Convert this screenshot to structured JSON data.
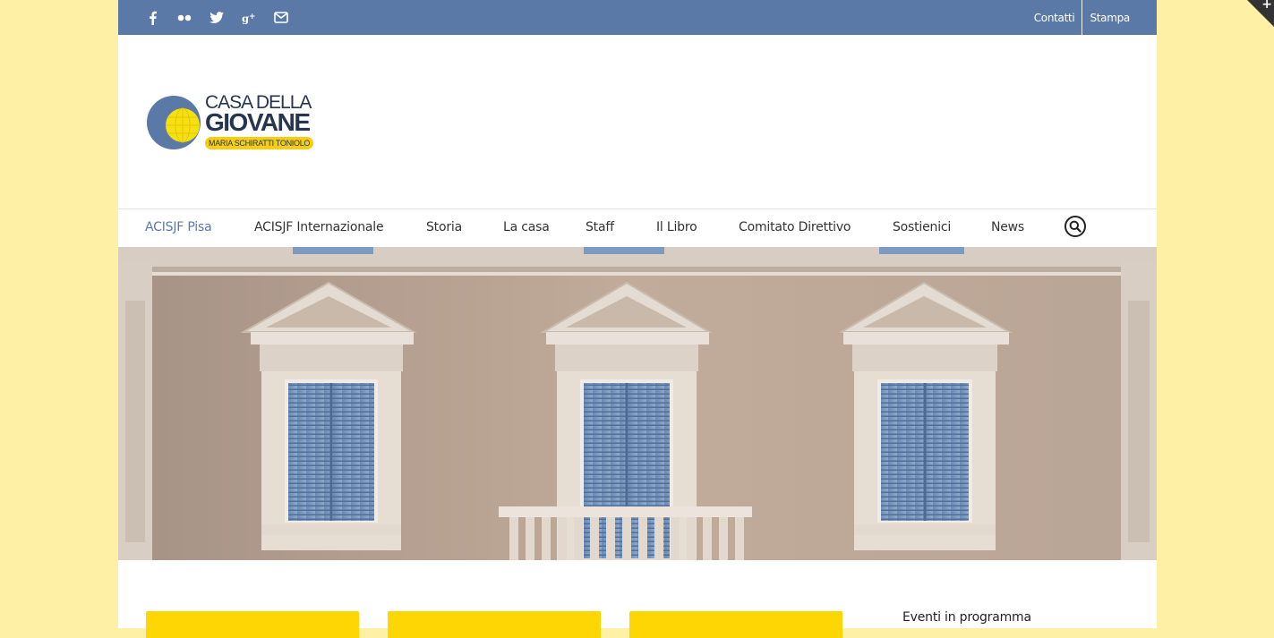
{
  "topbar": {
    "social_icons": [
      "facebook-icon",
      "flickr-icon",
      "twitter-icon",
      "google-plus-icon",
      "mail-icon"
    ],
    "links": [
      "Contatti",
      "Stampa"
    ],
    "color": "#5b79a6"
  },
  "logo": {
    "line1": "CASA DELLA",
    "line2": "GIOVANE",
    "tagline": "MARIA SCHIRATTI TONIOLO"
  },
  "nav": {
    "items": [
      "ACISJF Pisa",
      "ACISJF Internazionale",
      "Storia",
      "La casa",
      "Staff",
      "Il Libro",
      "Comitato Direttivo",
      "Sostienici",
      "News"
    ],
    "active": "ACISJF Pisa"
  },
  "sidebar": {
    "events_title": "Eventi in programma"
  },
  "colors": {
    "background": "#fef0a4",
    "accent": "#5b79a6",
    "card": "#fdd603"
  }
}
